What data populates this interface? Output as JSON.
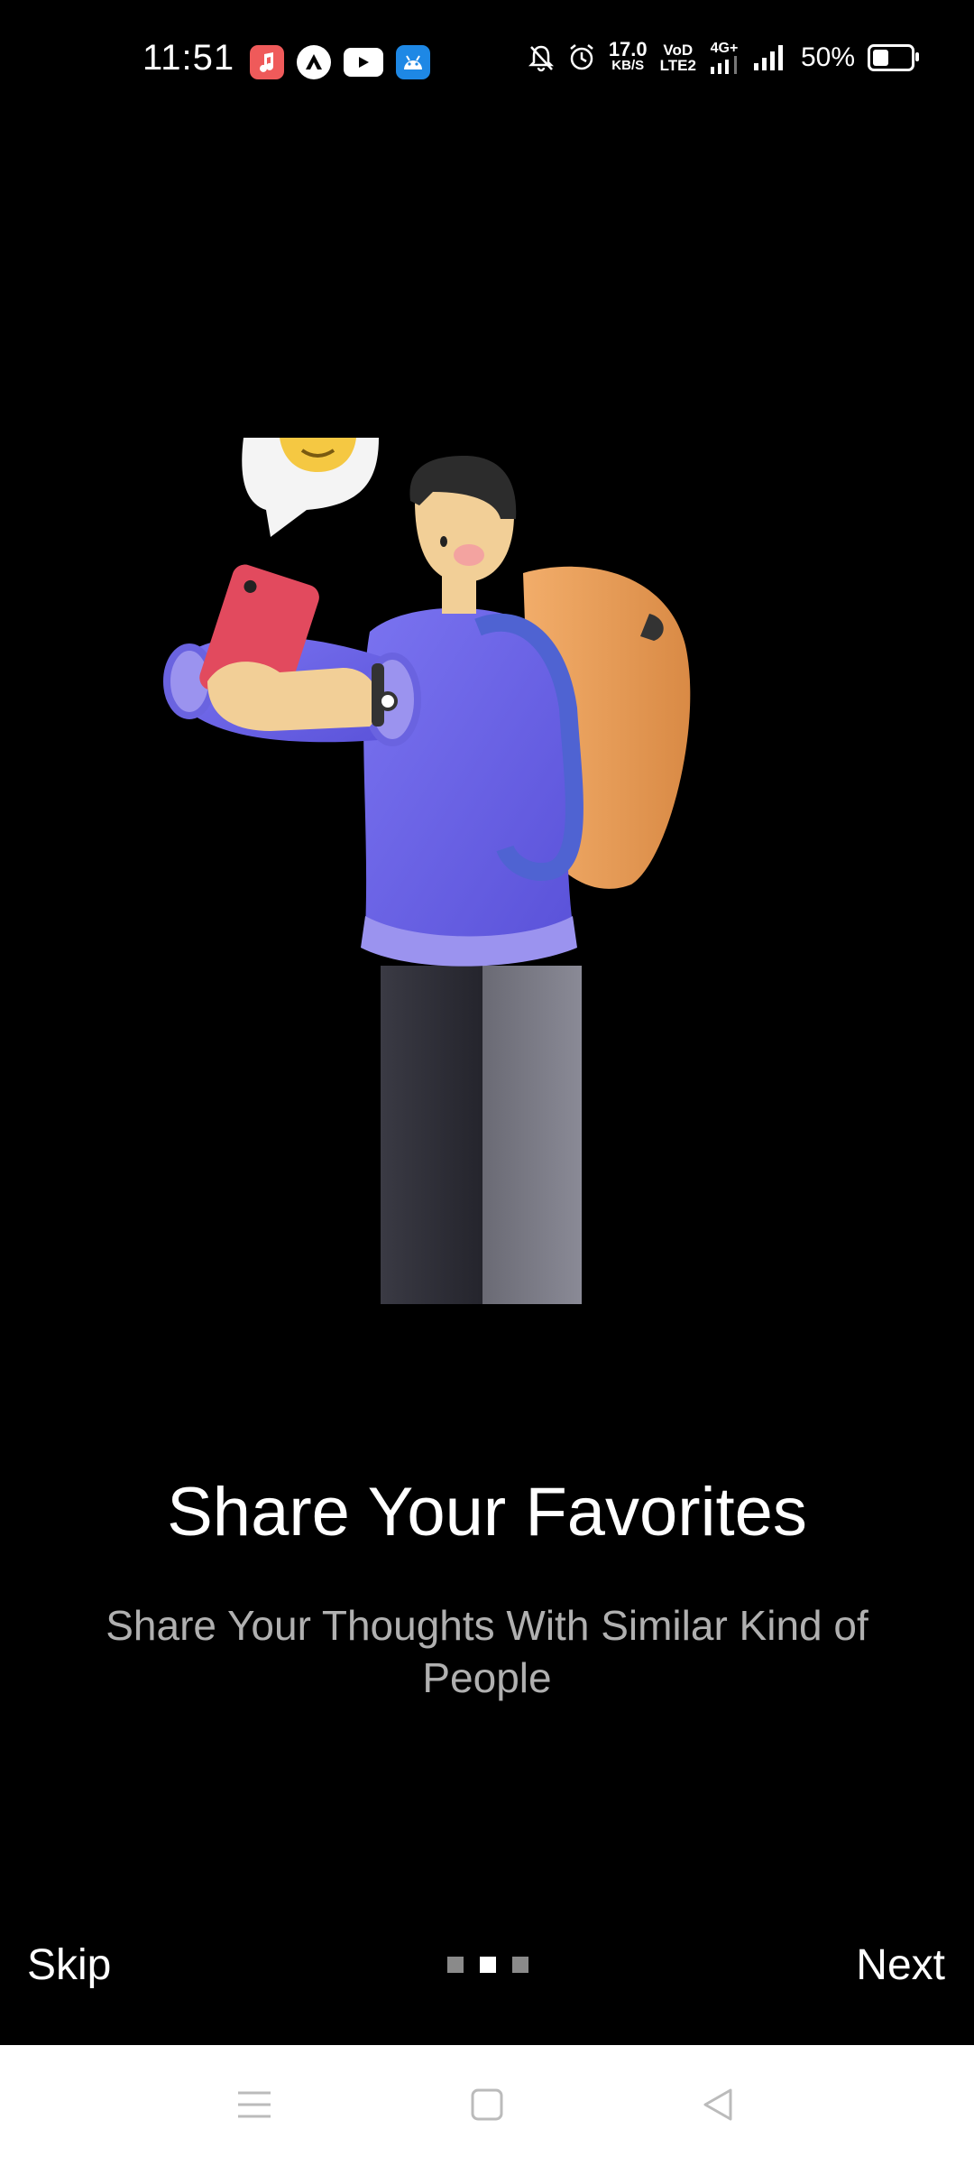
{
  "status_bar": {
    "time": "11:51",
    "net_speed": "17.0",
    "net_unit": "KB/S",
    "volte_top": "VoD",
    "volte_bottom": "LTE2",
    "network": "4G+",
    "battery": "50%",
    "app_icons": [
      "music-app-icon",
      "nav-app-icon",
      "youtube-icon",
      "android-debug-icon"
    ],
    "colors": {
      "music": "#ef5a5a",
      "youtube": "#ffffff",
      "android": "#1e88e5"
    }
  },
  "onboarding": {
    "title": "Share Your Favorites",
    "subtitle": "Share Your Thoughts With Similar Kind of People",
    "skip_label": "Skip",
    "next_label": "Next",
    "page_indicator": {
      "count": 3,
      "active_index": 1
    }
  },
  "nav_bar": {
    "buttons": [
      "menu-icon",
      "home-icon",
      "back-icon"
    ]
  },
  "colors": {
    "background": "#000000",
    "shirt": "#6f67e8",
    "backpack": "#e79a55",
    "phone": "#e24a5e",
    "skin": "#f2cf97",
    "bubble_emoji": "#f5c842"
  }
}
